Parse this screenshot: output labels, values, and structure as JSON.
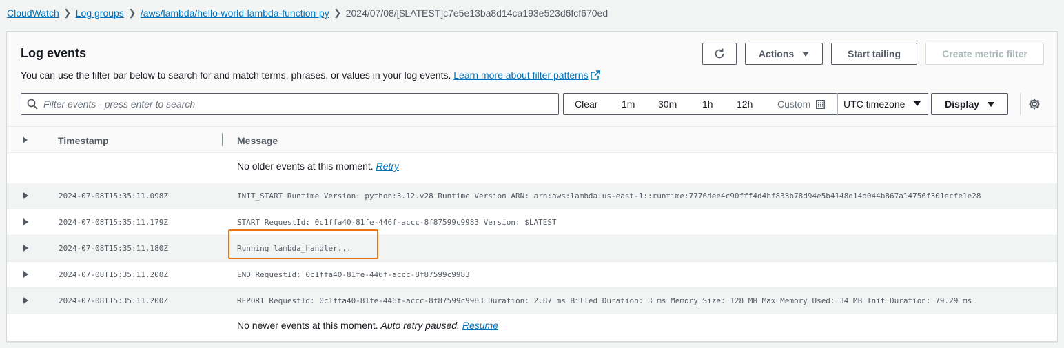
{
  "breadcrumb": {
    "items": [
      "CloudWatch",
      "Log groups",
      "/aws/lambda/hello-world-lambda-function-py"
    ],
    "current": "2024/07/08/[$LATEST]c7e5e13ba8d14ca193e523d6fcf670ed"
  },
  "panel": {
    "title": "Log events",
    "description": "You can use the filter bar below to search for and match terms, phrases, or values in your log events.",
    "learn_more": "Learn more about filter patterns"
  },
  "toolbar": {
    "refresh_icon": "refresh-icon",
    "actions_label": "Actions",
    "start_tailing_label": "Start tailing",
    "create_metric_filter_label": "Create metric filter"
  },
  "filter": {
    "placeholder": "Filter events - press enter to search",
    "clear": "Clear",
    "ranges": [
      "1m",
      "30m",
      "1h",
      "12h"
    ],
    "custom": "Custom",
    "timezone": "UTC timezone",
    "display": "Display"
  },
  "table": {
    "headers": {
      "timestamp": "Timestamp",
      "message": "Message"
    },
    "top_notice": "No older events at this moment.",
    "retry": "Retry",
    "bottom_notice": "No newer events at this moment.",
    "auto_retry": "Auto retry paused.",
    "resume": "Resume",
    "rows": [
      {
        "timestamp": "2024-07-08T15:35:11.098Z",
        "message": "INIT_START Runtime Version: python:3.12.v28 Runtime Version ARN: arn:aws:lambda:us-east-1::runtime:7776dee4c90fff4d4bf833b78d94e5b4148d14d044b867a14756f301ecfe1e28"
      },
      {
        "timestamp": "2024-07-08T15:35:11.179Z",
        "message": "START RequestId: 0c1ffa40-81fe-446f-accc-8f87599c9983 Version: $LATEST"
      },
      {
        "timestamp": "2024-07-08T15:35:11.180Z",
        "message": "Running lambda_handler..."
      },
      {
        "timestamp": "2024-07-08T15:35:11.200Z",
        "message": "END RequestId: 0c1ffa40-81fe-446f-accc-8f87599c9983"
      },
      {
        "timestamp": "2024-07-08T15:35:11.200Z",
        "message": "REPORT RequestId: 0c1ffa40-81fe-446f-accc-8f87599c9983 Duration: 2.87 ms Billed Duration: 3 ms Memory Size: 128 MB Max Memory Used: 34 MB Init Duration: 79.29 ms"
      }
    ]
  },
  "colors": {
    "link": "#0073bb",
    "highlight": "#ec7211"
  }
}
